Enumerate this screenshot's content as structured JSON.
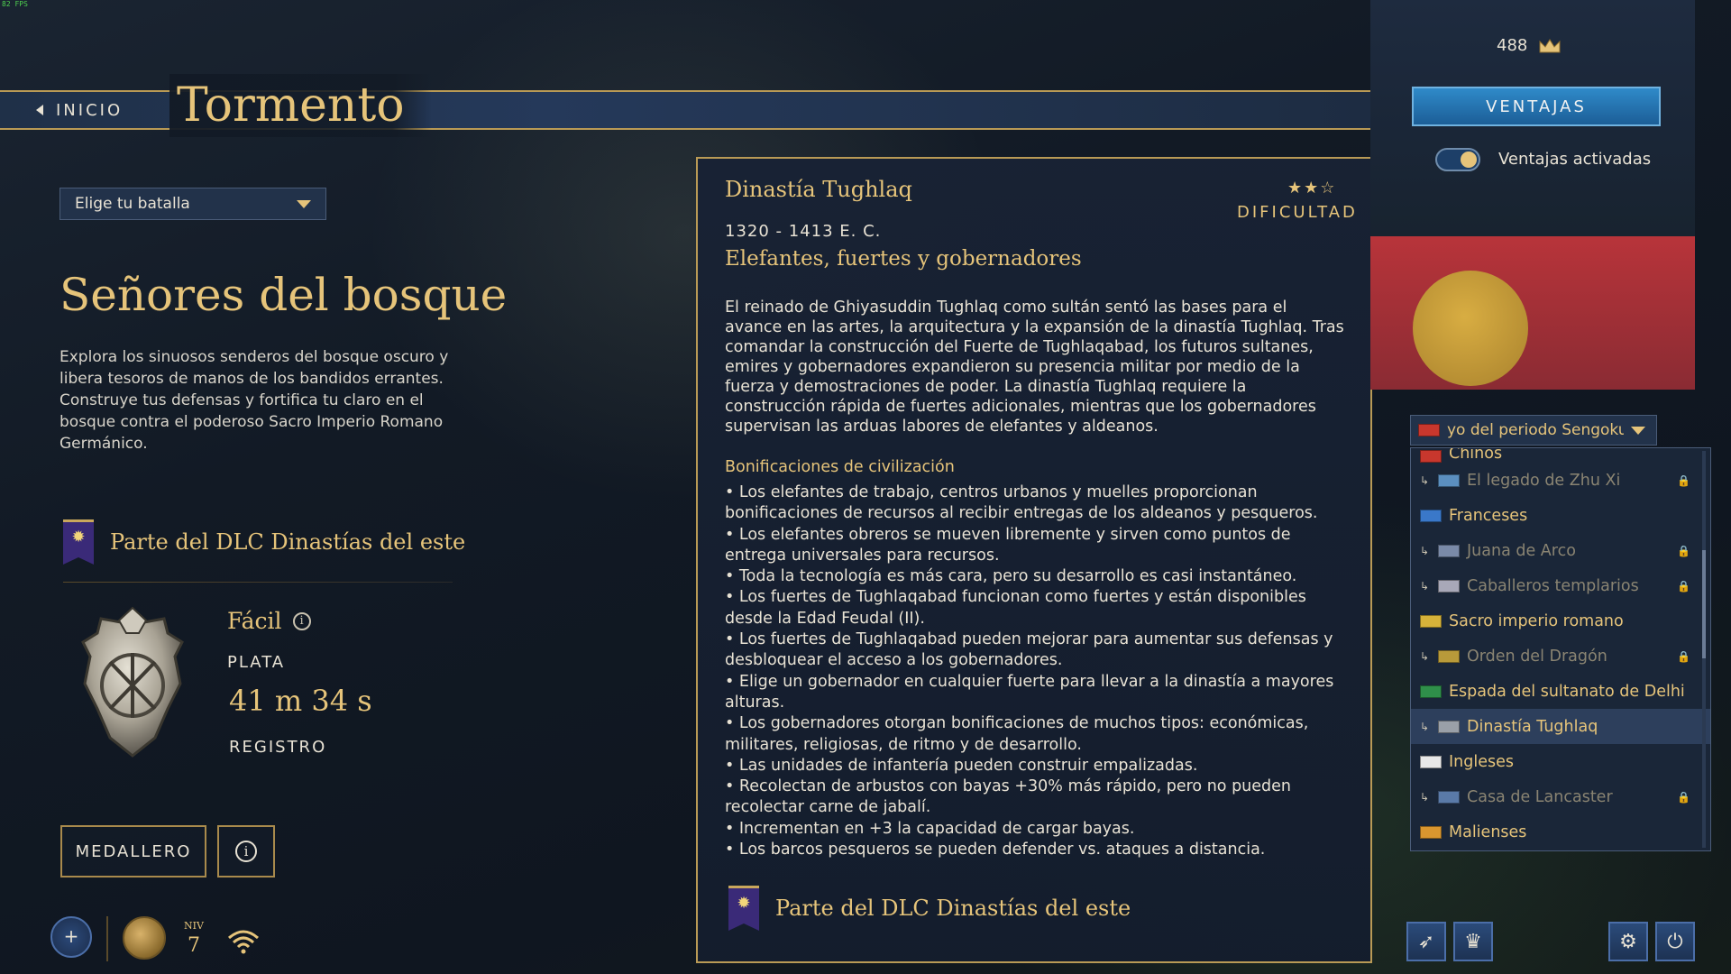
{
  "fps": "82 FPS",
  "header": {
    "back_label": "INICIO",
    "title": "Tormento"
  },
  "left": {
    "battle_select": "Elige tu batalla",
    "mission_title": "Señores del bosque",
    "mission_desc": "Explora los sinuosos senderos del bosque oscuro y libera tesoros de manos de los bandidos errantes. Construye tus defensas y fortifica tu claro en el bosque contra el poderoso Sacro Imperio Romano Germánico.",
    "dlc_text": "Parte del DLC Dinastías del este",
    "difficulty": "Fácil",
    "rank": "PLATA",
    "time": "41 m 34 s",
    "record": "REGISTRO",
    "medal_button": "MEDALLERO"
  },
  "status": {
    "plus": "+",
    "level_label": "NIV",
    "level_value": "7"
  },
  "civ": {
    "name": "Dinastía Tughlaq",
    "stars": "★★☆",
    "difficulty_label": "DIFICULTAD",
    "period": "1320 - 1413 E. C.",
    "tagline": "Elefantes, fuertes y gobernadores",
    "description": "El reinado de Ghiyasuddin Tughlaq como sultán sentó las bases para el avance en las artes, la arquitectura y la expansión de la dinastía Tughlaq. Tras comandar la construcción del Fuerte de Tughlaqabad, los futuros sultanes, emires y gobernadores expandieron su presencia militar por medio de la fuerza y demostraciones de poder. La dinastía Tughlaq requiere la construcción rápida de fuertes adicionales, mientras que los gobernadores supervisan las arduas labores de elefantes y aldeanos.",
    "bonus_title": "Bonificaciones de civilización",
    "bonuses": [
      "Los elefantes de trabajo, centros urbanos y muelles proporcionan bonificaciones de recursos al recibir entregas de los aldeanos y pesqueros.",
      "Los elefantes obreros se mueven libremente y sirven como puntos de entrega universales para recursos.",
      "Toda la tecnología es más cara, pero su desarrollo es casi instantáneo.",
      "Los fuertes de Tughlaqabad funcionan como fuertes y están disponibles desde la Edad Feudal (II).",
      "Los fuertes de Tughlaqabad pueden mejorar para aumentar sus defensas y desbloquear el acceso a los gobernadores.",
      "Elige un gobernador en cualquier fuerte para llevar a la dinastía a mayores alturas.",
      "Los gobernadores otorgan bonificaciones de muchos tipos: económicas, militares, religiosas, de ritmo y de desarrollo.",
      "Las unidades de infantería pueden construir empalizadas.",
      "Recolectan de arbustos con bayas +30% más rápido, pero no pueden recolectar carne de jabalí.",
      "Incrementan en +3 la capacidad de cargar bayas.",
      "Los barcos pesqueros se pueden defender vs. ataques a distancia."
    ],
    "dlc_text": "Parte del DLC Dinastías del este"
  },
  "right": {
    "crowns": "488",
    "advantages_button": "VENTAJAS",
    "toggle_label": "Ventajas activadas",
    "civ_select": "Shogunato Tokugawa — Ensayo del periodo Sengoku",
    "civ_select_visible": "yo del periodo Sengoku",
    "civ_list": [
      {
        "label": "Chinos",
        "sub": false,
        "locked": false,
        "flag": "#c8372d",
        "partial": true
      },
      {
        "label": "El legado de Zhu Xi",
        "sub": true,
        "locked": true,
        "flag": "#5b8fc0"
      },
      {
        "label": "Franceses",
        "sub": false,
        "locked": false,
        "flag": "#3a78c9"
      },
      {
        "label": "Juana de Arco",
        "sub": true,
        "locked": true,
        "flag": "#7a8aa8"
      },
      {
        "label": "Caballeros templarios",
        "sub": true,
        "locked": true,
        "flag": "#a8a8b8"
      },
      {
        "label": "Sacro imperio romano",
        "sub": false,
        "locked": false,
        "flag": "#d6b23a"
      },
      {
        "label": "Orden del Dragón",
        "sub": true,
        "locked": true,
        "flag": "#b89a3a"
      },
      {
        "label": "Espada del sultanato de Delhi",
        "sub": false,
        "locked": false,
        "flag": "#2f8f4a"
      },
      {
        "label": "Dinastía Tughlaq",
        "sub": true,
        "locked": false,
        "flag": "#9aa0a8",
        "selected": true
      },
      {
        "label": "Ingleses",
        "sub": false,
        "locked": false,
        "flag": "#e8e8e8"
      },
      {
        "label": "Casa de Lancaster",
        "sub": true,
        "locked": true,
        "flag": "#5a7aa8"
      },
      {
        "label": "Malienses",
        "sub": false,
        "locked": false,
        "flag": "#d9962f"
      }
    ],
    "lock_glyph": "🔒",
    "sub_glyph": "↳"
  },
  "icons": {
    "settings": "gear-icon",
    "power": "power-icon",
    "horn": "horn-icon",
    "crown": "crown-icon"
  },
  "colors": {
    "accent_gold": "#e6c47a",
    "panel_border": "#b99a55",
    "button_blue": "#2f8ac9"
  }
}
